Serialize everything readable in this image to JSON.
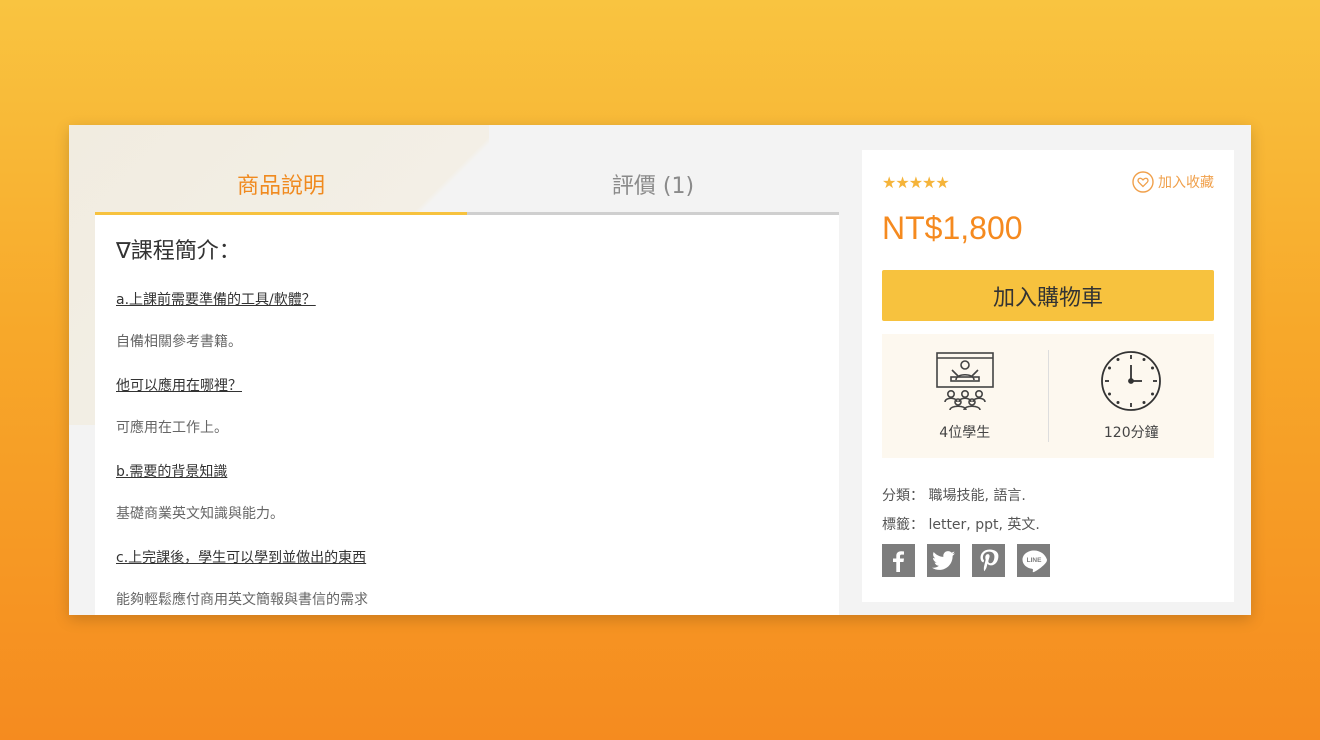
{
  "tabs": [
    {
      "label": "商品說明",
      "active": true
    },
    {
      "label": "評價 (1)",
      "active": false
    }
  ],
  "description": {
    "heading": "∇課程簡介：",
    "qa": [
      {
        "q": "a.上課前需要準備的工具/軟體？",
        "a": "自備相關參考書籍。"
      },
      {
        "q": "他可以應用在哪裡？",
        "a": "可應用在工作上。"
      },
      {
        "q": "b.需要的背景知識",
        "a": "基礎商業英文知識與能力。"
      },
      {
        "q": "c.上完課後，學生可以學到並做出的東西",
        "a": "能夠輕鬆應付商用英文簡報與書信的需求"
      }
    ]
  },
  "product": {
    "rating": 5,
    "stars": "★★★★★",
    "favorite_label": "加入收藏",
    "price": "NT$1,800",
    "cart_label": "加入購物車",
    "students_label": "4位學生",
    "duration_label": "120分鐘",
    "category_label": "分類：",
    "categories": "職場技能, 語言.",
    "tags_label": "標籤：",
    "tags": "letter, ppt, 英文."
  },
  "colors": {
    "accent_orange": "#f58a1f",
    "accent_yellow": "#f7c23e",
    "star": "#f5b43a",
    "social_gray": "#7d7d7d"
  },
  "social_icons": [
    "facebook-icon",
    "twitter-icon",
    "pinterest-icon",
    "line-icon"
  ]
}
